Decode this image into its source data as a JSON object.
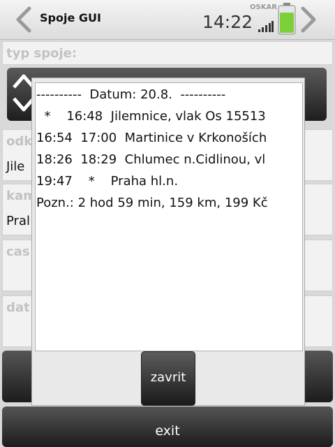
{
  "statusbar": {
    "title": "Spoje GUI",
    "time": "14:22",
    "carrier": "OSKAR",
    "battery_color": "#7ccf3a"
  },
  "form": {
    "type_label": "typ spoje:",
    "from_label": "odk",
    "from_value": "Jile",
    "to_label": "kam",
    "to_value": "Pral",
    "time_label": "cas",
    "date_label": "dat",
    "exit_label": "exit"
  },
  "dialog": {
    "lines": [
      "----------  Datum: 20.8.  ----------",
      "  *    16:48  Jilemnice, vlak Os 15513",
      "16:54  17:00  Martinice v Krkonoších",
      "18:26  18:29  Chlumec n.Cidlinou, vl",
      "19:47    *    Praha hl.n.",
      "Pozn.: 2 hod 59 min, 159 km, 199 Kč"
    ],
    "close_label": "zavrit"
  }
}
